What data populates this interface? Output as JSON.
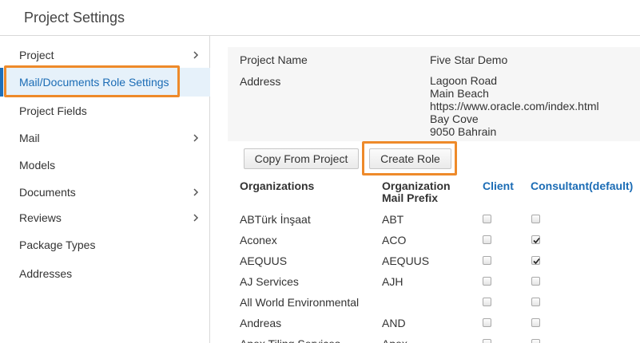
{
  "header": {
    "title": "Project Settings"
  },
  "sidebar": {
    "items": [
      {
        "label": "Project",
        "has_submenu": true,
        "active": false
      },
      {
        "label": "Mail/Documents Role Settings",
        "has_submenu": false,
        "active": true
      },
      {
        "label": "Project Fields",
        "has_submenu": false,
        "active": false
      },
      {
        "label": "Mail",
        "has_submenu": true,
        "active": false
      },
      {
        "label": "Models",
        "has_submenu": false,
        "active": false
      },
      {
        "label": "Documents",
        "has_submenu": true,
        "active": false
      },
      {
        "label": "Reviews",
        "has_submenu": true,
        "active": false
      },
      {
        "label": "Package Types",
        "has_submenu": false,
        "active": false
      },
      {
        "label": "Addresses",
        "has_submenu": false,
        "active": false
      }
    ]
  },
  "project_info": {
    "name_label": "Project Name",
    "name_value": "Five Star Demo",
    "address_label": "Address",
    "address_lines": [
      "Lagoon Road",
      "Main Beach",
      "https://www.oracle.com/index.html",
      "Bay Cove",
      "9050 Bahrain"
    ]
  },
  "actions": {
    "copy_from_project": "Copy From Project",
    "create_role": "Create Role"
  },
  "table": {
    "headers": {
      "organizations": "Organizations",
      "mail_prefix_line1": "Organization",
      "mail_prefix_line2": "Mail Prefix",
      "client": "Client",
      "consultant": "Consultant(default)"
    },
    "rows": [
      {
        "organization": "ABTürk İnşaat",
        "prefix": "ABT",
        "client": false,
        "consultant": false
      },
      {
        "organization": "Aconex",
        "prefix": "ACO",
        "client": false,
        "consultant": true
      },
      {
        "organization": "AEQUUS",
        "prefix": "AEQUUS",
        "client": false,
        "consultant": true
      },
      {
        "organization": "AJ Services",
        "prefix": "AJH",
        "client": false,
        "consultant": false
      },
      {
        "organization": "All World Environmental",
        "prefix": "",
        "client": false,
        "consultant": false
      },
      {
        "organization": "Andreas",
        "prefix": "AND",
        "client": false,
        "consultant": false
      },
      {
        "organization": "Apex Tiling Services",
        "prefix": "Apex",
        "client": false,
        "consultant": false
      }
    ]
  },
  "colors": {
    "accent_blue": "#1b6cb5",
    "highlight_orange": "#ee8a2a",
    "active_bg": "#e6f1fa"
  }
}
